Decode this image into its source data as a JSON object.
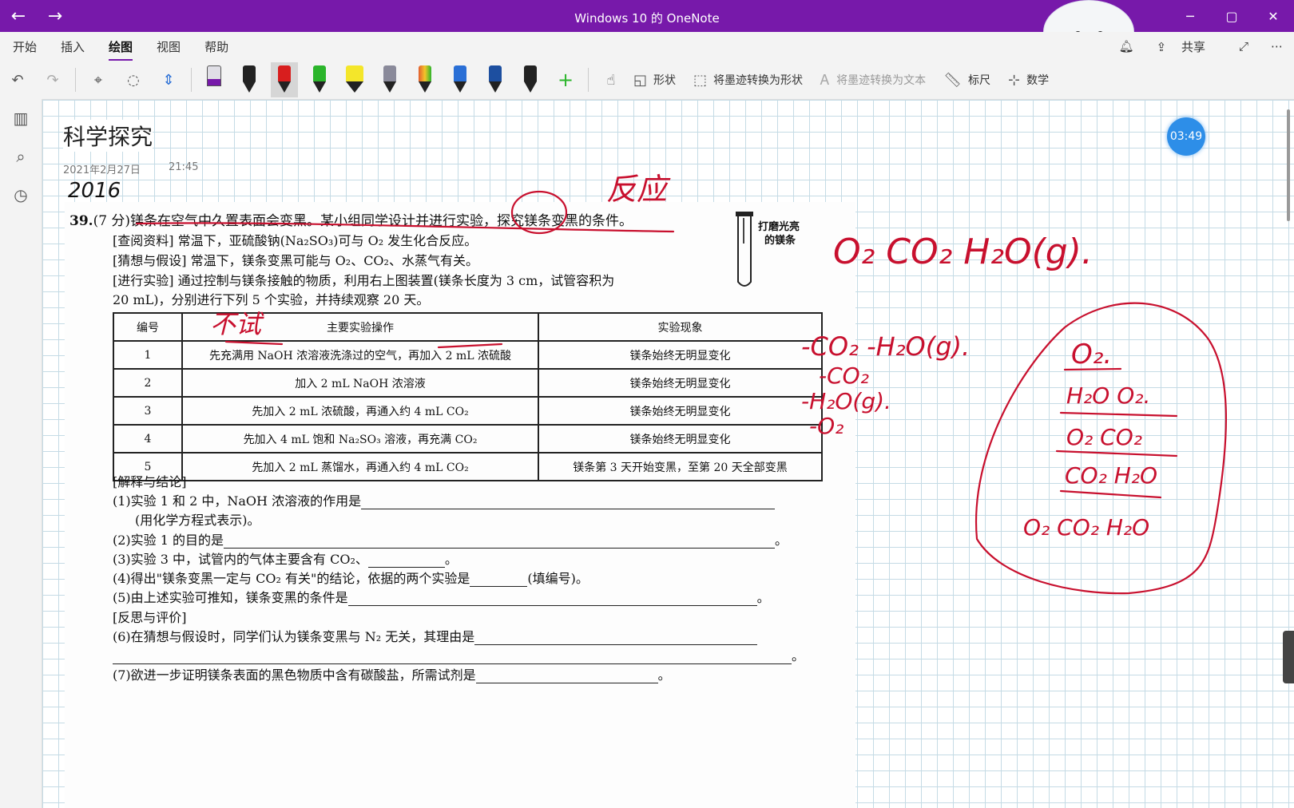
{
  "window": {
    "title": "Windows 10 的 OneNote",
    "back_label": "←",
    "forward_label": "→",
    "min_label": "─",
    "max_label": "▢",
    "close_label": "✕"
  },
  "ribbon_tabs": [
    "开始",
    "插入",
    "绘图",
    "视图",
    "帮助"
  ],
  "ribbon_right": {
    "share_label": "共享"
  },
  "toolbar": {
    "shapes_label": "形状",
    "ink_to_shape_label": "将墨迹转换为形状",
    "ink_to_text_label": "将墨迹转换为文本",
    "ruler_label": "标尺",
    "math_label": "数学",
    "pens": [
      {
        "name": "pen-black-1",
        "color": "#222222"
      },
      {
        "name": "pen-red",
        "color": "#d81e1e"
      },
      {
        "name": "pen-green",
        "color": "#2bb52b"
      },
      {
        "name": "highlighter-yellow",
        "color": "#f4e62a"
      },
      {
        "name": "pen-galaxy",
        "color": "#8a8a9a"
      },
      {
        "name": "pen-rainbow",
        "color": "#e35d2f"
      },
      {
        "name": "pen-blue",
        "color": "#2a6fd6"
      },
      {
        "name": "pen-darkblue",
        "color": "#1d4fa0"
      },
      {
        "name": "pen-black-2",
        "color": "#222222"
      }
    ]
  },
  "page": {
    "title": "科学探究",
    "date": "2021年2月27日",
    "time": "21:45",
    "timer": "03:49"
  },
  "worksheet": {
    "q_number": "39.",
    "q_intro": "(7 分)镁条在空气中久置表面会变黑。某小组同学设计并进行实验，探究镁条变黑的条件。",
    "line_ref": "[查阅资料]  常温下，亚硫酸钠(Na₂SO₃)可与 O₂ 发生化合反应。",
    "line_hyp": "[猜想与假设]  常温下，镁条变黑可能与 O₂、CO₂、水蒸气有关。",
    "line_exp1": "[进行实验]  通过控制与镁条接触的物质，利用右上图装置(镁条长度为 3 cm，试管容积为",
    "line_exp2": "20 mL)，分别进行下列 5 个实验，并持续观察 20 天。",
    "tube_label_1": "打磨光亮",
    "tube_label_2": "的镁条",
    "table_headers": [
      "编号",
      "主要实验操作",
      "实验现象"
    ],
    "table_rows": [
      [
        "1",
        "先充满用 NaOH 浓溶液洗涤过的空气，再加入 2 mL 浓硫酸",
        "镁条始终无明显变化"
      ],
      [
        "2",
        "加入 2 mL NaOH 浓溶液",
        "镁条始终无明显变化"
      ],
      [
        "3",
        "先加入 2 mL 浓硫酸，再通入约 4 mL CO₂",
        "镁条始终无明显变化"
      ],
      [
        "4",
        "先加入 4 mL 饱和 Na₂SO₃ 溶液，再充满 CO₂",
        "镁条始终无明显变化"
      ],
      [
        "5",
        "先加入 2 mL 蒸馏水，再通入约 4 mL CO₂",
        "镁条第 3 天开始变黑，至第 20 天全部变黑"
      ]
    ],
    "conclusion_head": "[解释与结论]",
    "c1": "(1)实验 1 和 2 中，NaOH 浓溶液的作用是",
    "c1b": "(用化学方程式表示)。",
    "c2": "(2)实验 1 的目的是",
    "c3": "(3)实验 3 中，试管内的气体主要含有 CO₂、",
    "c4a": "(4)得出\"镁条变黑一定与 CO₂ 有关\"的结论，依据的两个实验是",
    "c4b": "(填编号)。",
    "c5": "(5)由上述实验可推知，镁条变黑的条件是",
    "reflect_head": "[反思与评价]",
    "c6": "(6)在猜想与假设时，同学们认为镁条变黑与 N₂ 无关，其理由是",
    "c7": "(7)欲进一步证明镁条表面的黑色物质中含有碳酸盐，所需试剂是",
    "period": "。"
  },
  "ink_notes": {
    "top_word": "反应",
    "table_note": "不试",
    "year_scrawl": "2016",
    "gases_line": "O₂  CO₂  H₂O(g).",
    "minus_line": "-CO₂  -H₂O(g).",
    "m1": "-CO₂",
    "m2": "-H₂O(g).",
    "m3": "-O₂",
    "circle_rows": [
      "O₂.",
      "H₂O   O₂.",
      "O₂    CO₂",
      "CO₂ H₂O",
      "O₂   CO₂  H₂O"
    ]
  }
}
